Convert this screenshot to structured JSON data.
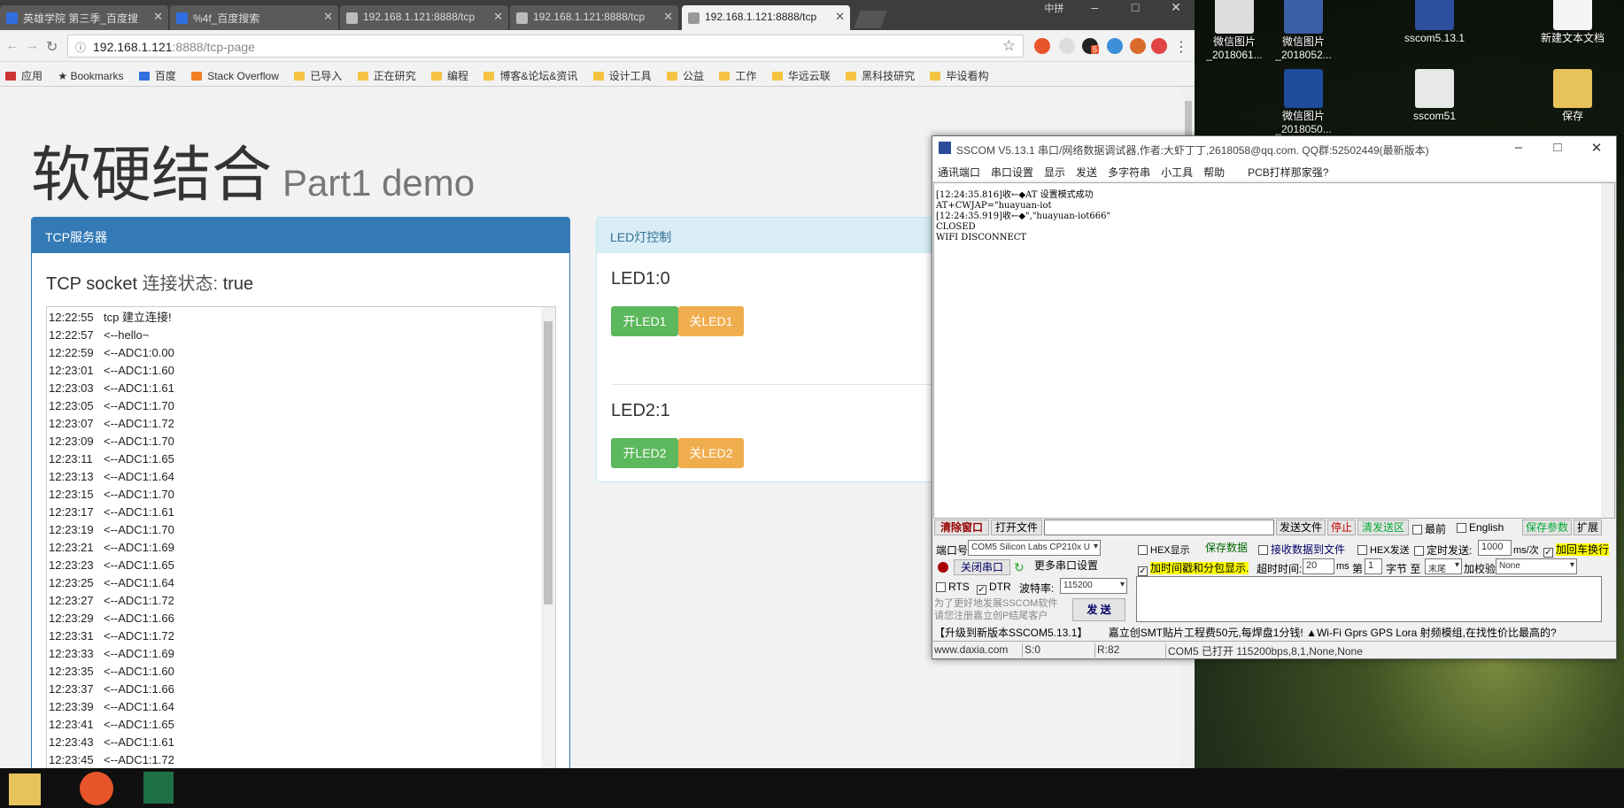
{
  "browser": {
    "tabs": [
      {
        "label": "英雄学院 第三季_百度搜",
        "active": false
      },
      {
        "label": "%4f_百度搜索",
        "active": false
      },
      {
        "label": "192.168.1.121:8888/tcp",
        "active": false
      },
      {
        "label": "192.168.1.121:8888/tcp",
        "active": false
      },
      {
        "label": "192.168.1.121:8888/tcp",
        "active": true
      }
    ],
    "url_host": "192.168.1.121",
    "url_rest": ":8888/tcp-page",
    "badge": "5",
    "bookmarks": [
      "应用",
      "Bookmarks",
      "百度",
      "Stack Overflow",
      "已导入",
      "正在研究",
      "编程",
      "博客&论坛&资讯",
      "设计工具",
      "公益",
      "工作",
      "华远云联",
      "黑科技研究",
      "毕设看构"
    ],
    "ime_text": "中拼"
  },
  "page": {
    "title": "软硬结合",
    "subtitle": "Part1 demo",
    "tcp_panel": {
      "heading": "TCP服务器",
      "socket_prefix": "TCP socket",
      "socket_label": "连接状态:",
      "socket_value": "true",
      "log": [
        {
          "time": "12:22:55",
          "msg": "tcp 建立连接!"
        },
        {
          "time": "12:22:57",
          "msg": "<--hello~"
        },
        {
          "time": "12:22:59",
          "msg": "<--ADC1:0.00"
        },
        {
          "time": "12:23:01",
          "msg": "<--ADC1:1.60"
        },
        {
          "time": "12:23:03",
          "msg": "<--ADC1:1.61"
        },
        {
          "time": "12:23:05",
          "msg": "<--ADC1:1.70"
        },
        {
          "time": "12:23:07",
          "msg": "<--ADC1:1.72"
        },
        {
          "time": "12:23:09",
          "msg": "<--ADC1:1.70"
        },
        {
          "time": "12:23:11",
          "msg": "<--ADC1:1.65"
        },
        {
          "time": "12:23:13",
          "msg": "<--ADC1:1.64"
        },
        {
          "time": "12:23:15",
          "msg": "<--ADC1:1.70"
        },
        {
          "time": "12:23:17",
          "msg": "<--ADC1:1.61"
        },
        {
          "time": "12:23:19",
          "msg": "<--ADC1:1.70"
        },
        {
          "time": "12:23:21",
          "msg": "<--ADC1:1.69"
        },
        {
          "time": "12:23:23",
          "msg": "<--ADC1:1.65"
        },
        {
          "time": "12:23:25",
          "msg": "<--ADC1:1.64"
        },
        {
          "time": "12:23:27",
          "msg": "<--ADC1:1.72"
        },
        {
          "time": "12:23:29",
          "msg": "<--ADC1:1.66"
        },
        {
          "time": "12:23:31",
          "msg": "<--ADC1:1.72"
        },
        {
          "time": "12:23:33",
          "msg": "<--ADC1:1.69"
        },
        {
          "time": "12:23:35",
          "msg": "<--ADC1:1.60"
        },
        {
          "time": "12:23:37",
          "msg": "<--ADC1:1.66"
        },
        {
          "time": "12:23:39",
          "msg": "<--ADC1:1.64"
        },
        {
          "time": "12:23:41",
          "msg": "<--ADC1:1.65"
        },
        {
          "time": "12:23:43",
          "msg": "<--ADC1:1.61"
        },
        {
          "time": "12:23:45",
          "msg": "<--ADC1:1.72"
        }
      ]
    },
    "led_panel": {
      "heading": "LED灯控制",
      "led1_status": "LED1:0",
      "led1_on": "开LED1",
      "led1_off": "关LED1",
      "led2_status": "LED2:1",
      "led2_on": "开LED2",
      "led2_off": "关LED2"
    }
  },
  "sscom": {
    "title": "SSCOM V5.13.1 串口/网络数据调试器,作者:大虾丁丁,2618058@qq.com. QQ群:52502449(最新版本)",
    "menu": [
      "通讯端口",
      "串口设置",
      "显示",
      "发送",
      "多字符串",
      "小工具",
      "帮助",
      "PCB打样那家强?"
    ],
    "recv_lines": [
      "[12:24:35.816]收←◆AT 设置模式成功",
      "AT+CWJAP=\"huayuan-iot",
      "[12:24:35.919]收←◆\",\"huayuan-iot666\"",
      "CLOSED",
      "WIFI DISCONNECT"
    ],
    "row1": {
      "clear": "清除窗口",
      "open_file": "打开文件",
      "send_file": "发送文件",
      "stop": "停止",
      "clear_send": "清发送区",
      "topmost": "最前",
      "english": "English",
      "save_params": "保存参数",
      "expand": "扩展"
    },
    "port_label": "端口号",
    "port_value": "COM5 Silicon Labs CP210x U",
    "hex_display": "HEX显示",
    "save_data": "保存数据",
    "recv_to_file": "接收数据到文件",
    "hex_send": "HEX发送",
    "timed_send": "定时发送:",
    "interval": "1000",
    "interval_unit": "ms/次",
    "add_crlf": "加回车换行",
    "close_port": "关闭串口",
    "more_settings": "更多串口设置",
    "timestamp": "加时间戳和分包显示.",
    "timeout_label": "超时时间:",
    "timeout_value": "20",
    "timeout_unit": "ms",
    "nth_label": "第",
    "nth_value": "1",
    "byte_label": "字节 至",
    "tail_value": "末尾",
    "checksum_label": "加校验",
    "checksum_value": "None",
    "rts": "RTS",
    "dtr": "DTR",
    "baud_label": "波特率:",
    "baud_value": "115200",
    "promo": "为了更好地发展SSCOM软件\n请您注册嘉立创P结尾客户",
    "send": "发 送",
    "ad_left": "【升级到新版本SSCOM5.13.1】",
    "ad_right": "嘉立创SMT贴片工程费50元,每焊盘1分钱! ▲Wi-Fi Gprs GPS Lora 射频模组,在找性价比最高的?",
    "status": {
      "site": "www.daxia.com",
      "s": "S:0",
      "r": "R:82",
      "port": "COM5 已打开  115200bps,8,1,None,None"
    }
  },
  "desktop": {
    "icons": [
      "微信图片_2018061...",
      "微信图片_2018052...",
      "sscom5.13.1",
      "新建文本文档",
      "微信图片_2018050...",
      "sscom51",
      "保存"
    ]
  }
}
